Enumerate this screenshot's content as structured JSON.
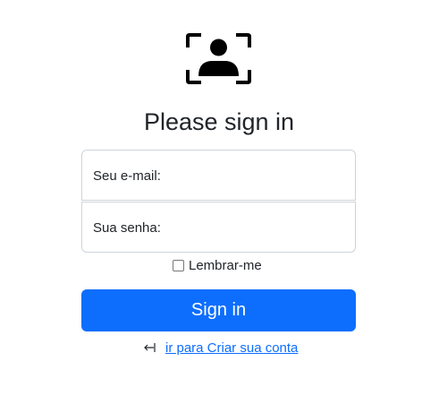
{
  "header": {
    "logo_icon": "user-scan-icon",
    "title": "Please sign in"
  },
  "form": {
    "email_label": "Seu e-mail:",
    "email_value": "",
    "password_label": "Sua senha:",
    "password_value": "",
    "remember_label": "Lembrar-me",
    "remember_checked": false,
    "submit_label": "Sign in"
  },
  "footer": {
    "back_icon": "arrow-left-to-line-icon",
    "create_account_label": "ir para Criar sua conta"
  },
  "colors": {
    "primary": "#0d6efd",
    "text": "#212529",
    "border": "#ced4da"
  }
}
